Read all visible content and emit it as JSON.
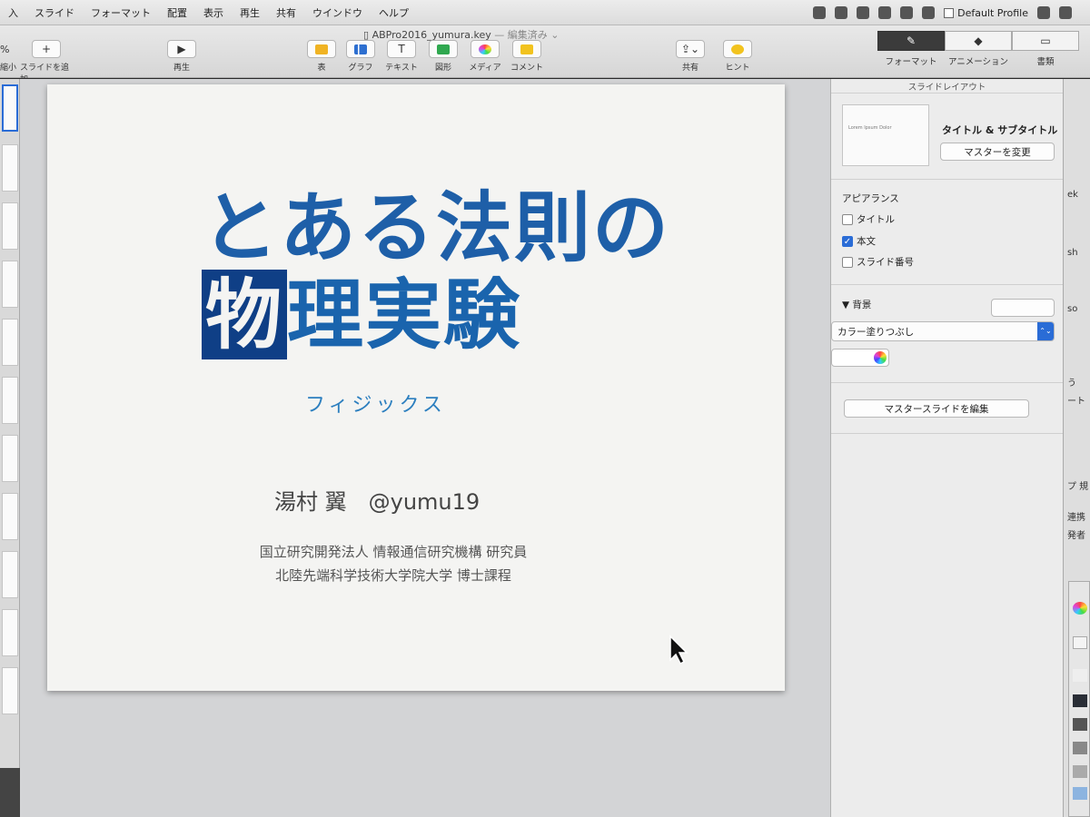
{
  "menubar": {
    "items": [
      "入",
      "スライド",
      "フォーマット",
      "配置",
      "表示",
      "再生",
      "共有",
      "ウインドウ",
      "ヘルプ"
    ],
    "profile": "Default Profile"
  },
  "toolbar": {
    "document_title": "ABPro2016_yumura.key",
    "document_status": "— 編集済み ⌄",
    "zoom_label": "%",
    "zoom_sub": "縮小",
    "add_slide": "スライドを追加",
    "play": "再生",
    "table": "表",
    "chart": "グラフ",
    "text": "テキスト",
    "shape": "図形",
    "media": "メディア",
    "comment": "コメント",
    "share": "共有",
    "tips": "ヒント"
  },
  "inspector_tabs": {
    "format": "フォーマット",
    "animate": "アニメーション",
    "document": "書類"
  },
  "slide": {
    "title_line1": "とある法則の",
    "title_boxed": "物",
    "title_line2_rest": "理実験",
    "ruby": "フィジックス",
    "author": "湯村 翼　@yumu19",
    "affiliation1": "国立研究開発法人 情報通信研究機構 研究員",
    "affiliation2": "北陸先端科学技術大学院大学 博士課程"
  },
  "inspector": {
    "header": "スライドレイアウト",
    "thumb_text": "Lorem Ipsum Dolor",
    "layout_name": "タイトル & サブタイトル",
    "change_master": "マスターを変更",
    "appearance_label": "アピアランス",
    "checkbox_title": "タイトル",
    "checkbox_body": "本文",
    "checkbox_slide_number": "スライド番号",
    "background_label": "背景",
    "fill_type": "カラー塗りつぶし",
    "edit_master": "マスタースライドを編集"
  },
  "right_strip": {
    "t1": "ek",
    "t2": "sh",
    "t3": "so",
    "t4": "う",
    "t5": "ート",
    "t6": "プ 規",
    "t7": "連携",
    "t8": "発者"
  }
}
